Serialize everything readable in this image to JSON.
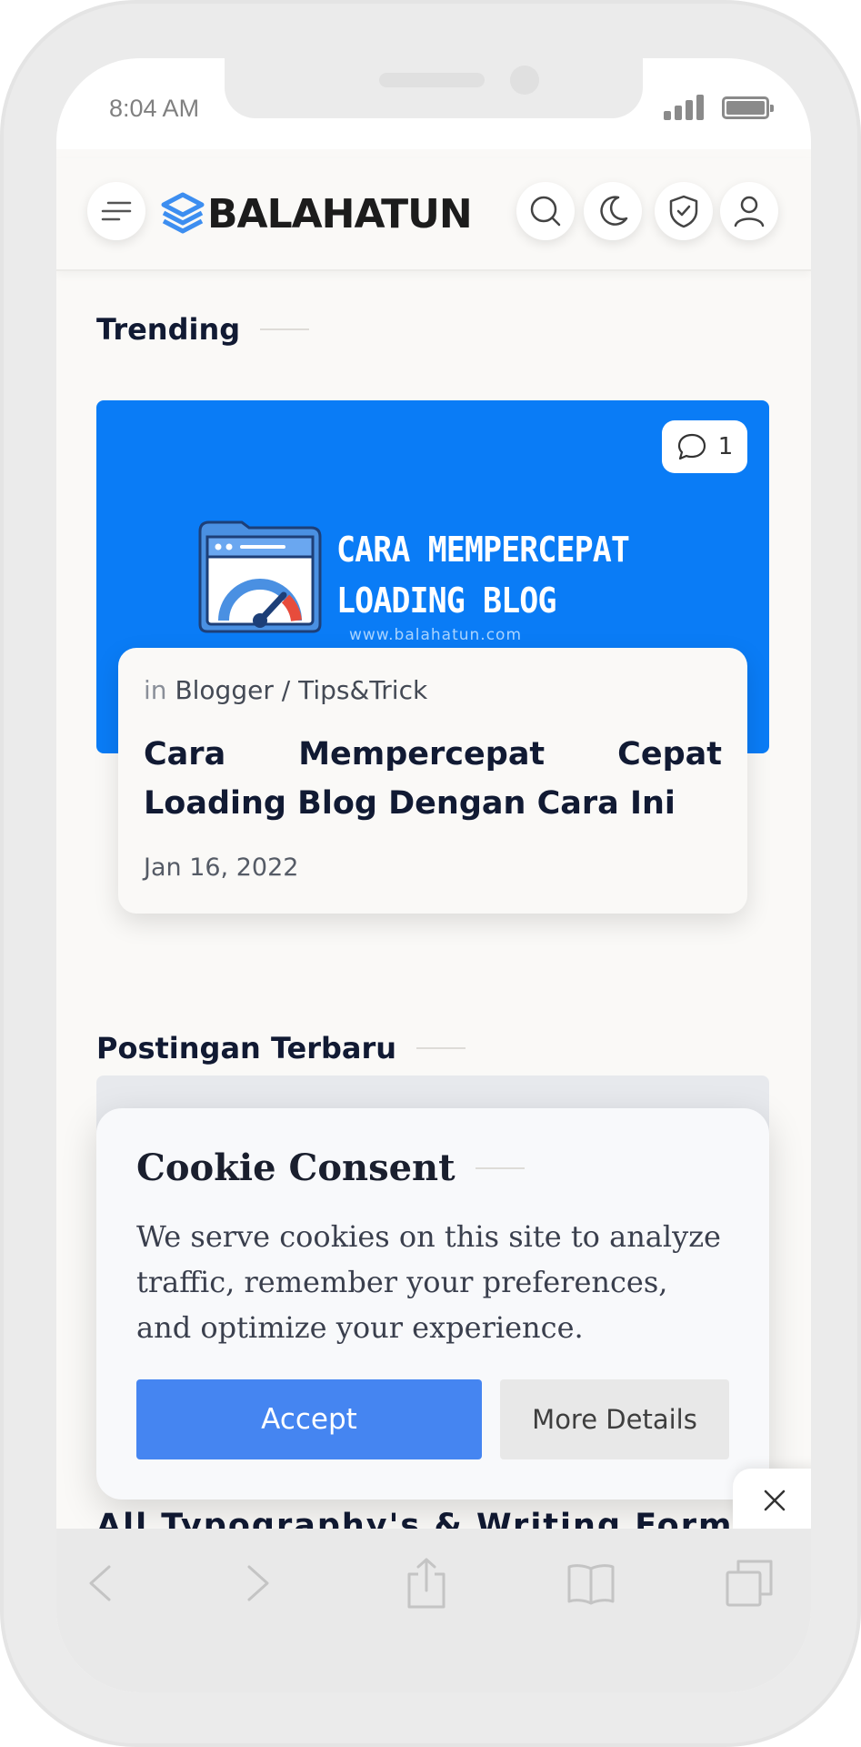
{
  "status_bar": {
    "time": "8:04 AM"
  },
  "header": {
    "brand": "BALAHATUN",
    "brand_color": "#3d8ef0",
    "icons": [
      "menu-icon",
      "search-icon",
      "moon-icon",
      "shield-check-icon",
      "user-icon"
    ]
  },
  "trending": {
    "section_title": "Trending",
    "post": {
      "comment_count": "1",
      "image_text_line1": "CARA MEMPERCEPAT",
      "image_text_line2": "LOADING BLOG",
      "image_url_text": "www.balahatun.com",
      "category_prefix": "in",
      "category": "Blogger / Tips&Trick",
      "title": "Cara Mempercepat Cepat Loading Blog Dengan Cara Ini",
      "date": "Jan 16, 2022"
    }
  },
  "latest": {
    "section_title": "Postingan Terbaru",
    "peek_title": "All Typography's & Writing Formats"
  },
  "cookie_consent": {
    "title": "Cookie Consent",
    "text": "We serve cookies on this site to analyze traffic, remember your preferences, and optimize your experience.",
    "accept_label": "Accept",
    "more_label": "More Details",
    "accept_color": "#4585f1"
  },
  "bottom_toolbar": {
    "icons": [
      "back-icon",
      "forward-icon",
      "share-icon",
      "bookmarks-icon",
      "tabs-icon"
    ]
  }
}
